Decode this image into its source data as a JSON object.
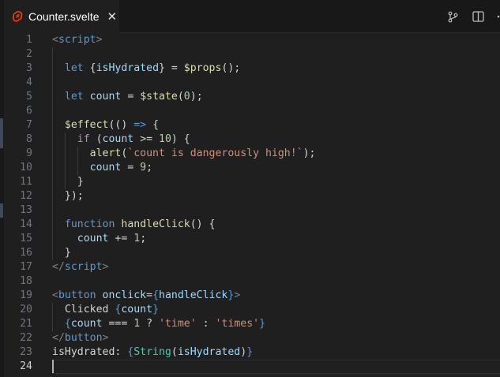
{
  "tab": {
    "title": "Counter.svelte",
    "close_glyph": "✕",
    "icon": "svelte-logo-icon"
  },
  "actions": [
    {
      "name": "source-control-icon"
    },
    {
      "name": "split-editor-icon"
    }
  ],
  "editor": {
    "active_line": 24,
    "lines": [
      {
        "n": 1,
        "tokens": [
          [
            "t-angle",
            "<"
          ],
          [
            "t-tag",
            "script"
          ],
          [
            "t-angle",
            ">"
          ]
        ]
      },
      {
        "n": 2,
        "tokens": []
      },
      {
        "n": 3,
        "tokens": [
          [
            "t-pun",
            "  "
          ],
          [
            "t-kw",
            "let"
          ],
          [
            "t-pun",
            " {"
          ],
          [
            "t-var",
            "isHydrated"
          ],
          [
            "t-pun",
            "} = "
          ],
          [
            "t-fn",
            "$props"
          ],
          [
            "t-pun",
            "();"
          ]
        ]
      },
      {
        "n": 4,
        "tokens": []
      },
      {
        "n": 5,
        "tokens": [
          [
            "t-pun",
            "  "
          ],
          [
            "t-kw",
            "let"
          ],
          [
            "t-pun",
            " "
          ],
          [
            "t-var",
            "count"
          ],
          [
            "t-pun",
            " = "
          ],
          [
            "t-fn",
            "$state"
          ],
          [
            "t-pun",
            "("
          ],
          [
            "t-num",
            "0"
          ],
          [
            "t-pun",
            ");"
          ]
        ]
      },
      {
        "n": 6,
        "tokens": []
      },
      {
        "n": 7,
        "tokens": [
          [
            "t-pun",
            "  "
          ],
          [
            "t-fn",
            "$effect"
          ],
          [
            "t-pun",
            "(() "
          ],
          [
            "t-kw",
            "=>"
          ],
          [
            "t-pun",
            " {"
          ]
        ]
      },
      {
        "n": 8,
        "tokens": [
          [
            "t-pun",
            "    "
          ],
          [
            "t-ctl",
            "if"
          ],
          [
            "t-pun",
            " ("
          ],
          [
            "t-var",
            "count"
          ],
          [
            "t-pun",
            " >= "
          ],
          [
            "t-num",
            "10"
          ],
          [
            "t-pun",
            ") {"
          ]
        ]
      },
      {
        "n": 9,
        "tokens": [
          [
            "t-pun",
            "      "
          ],
          [
            "t-fn",
            "alert"
          ],
          [
            "t-pun",
            "("
          ],
          [
            "t-str",
            "`count is dangerously high!`"
          ],
          [
            "t-pun",
            ");"
          ]
        ]
      },
      {
        "n": 10,
        "tokens": [
          [
            "t-pun",
            "      "
          ],
          [
            "t-var",
            "count"
          ],
          [
            "t-pun",
            " = "
          ],
          [
            "t-num",
            "9"
          ],
          [
            "t-pun",
            ";"
          ]
        ]
      },
      {
        "n": 11,
        "tokens": [
          [
            "t-pun",
            "    }"
          ]
        ]
      },
      {
        "n": 12,
        "tokens": [
          [
            "t-pun",
            "  });"
          ]
        ]
      },
      {
        "n": 13,
        "tokens": []
      },
      {
        "n": 14,
        "tokens": [
          [
            "t-pun",
            "  "
          ],
          [
            "t-kw",
            "function"
          ],
          [
            "t-pun",
            " "
          ],
          [
            "t-fn",
            "handleClick"
          ],
          [
            "t-pun",
            "() {"
          ]
        ]
      },
      {
        "n": 15,
        "tokens": [
          [
            "t-pun",
            "    "
          ],
          [
            "t-var",
            "count"
          ],
          [
            "t-pun",
            " += "
          ],
          [
            "t-num",
            "1"
          ],
          [
            "t-pun",
            ";"
          ]
        ]
      },
      {
        "n": 16,
        "tokens": [
          [
            "t-pun",
            "  }"
          ]
        ]
      },
      {
        "n": 17,
        "tokens": [
          [
            "t-angle",
            "</"
          ],
          [
            "t-tag",
            "script"
          ],
          [
            "t-angle",
            ">"
          ]
        ]
      },
      {
        "n": 18,
        "tokens": []
      },
      {
        "n": 19,
        "tokens": [
          [
            "t-angle",
            "<"
          ],
          [
            "t-tag",
            "button"
          ],
          [
            "t-pun",
            " "
          ],
          [
            "t-var",
            "onclick"
          ],
          [
            "t-pun",
            "="
          ],
          [
            "t-brace",
            "{"
          ],
          [
            "t-var",
            "handleClick"
          ],
          [
            "t-brace",
            "}"
          ],
          [
            "t-angle",
            ">"
          ]
        ]
      },
      {
        "n": 20,
        "tokens": [
          [
            "t-txt",
            "  Clicked "
          ],
          [
            "t-brace",
            "{"
          ],
          [
            "t-var",
            "count"
          ],
          [
            "t-brace",
            "}"
          ]
        ]
      },
      {
        "n": 21,
        "tokens": [
          [
            "t-pun",
            "  "
          ],
          [
            "t-brace",
            "{"
          ],
          [
            "t-var",
            "count"
          ],
          [
            "t-pun",
            " === "
          ],
          [
            "t-num",
            "1"
          ],
          [
            "t-pun",
            " ? "
          ],
          [
            "t-str",
            "'time'"
          ],
          [
            "t-pun",
            " : "
          ],
          [
            "t-str",
            "'times'"
          ],
          [
            "t-brace",
            "}"
          ]
        ]
      },
      {
        "n": 22,
        "tokens": [
          [
            "t-angle",
            "</"
          ],
          [
            "t-tag",
            "button"
          ],
          [
            "t-angle",
            ">"
          ]
        ]
      },
      {
        "n": 23,
        "tokens": [
          [
            "t-txt",
            "isHydrated: "
          ],
          [
            "t-brace",
            "{"
          ],
          [
            "t-type",
            "String"
          ],
          [
            "t-pun",
            "("
          ],
          [
            "t-var",
            "isHydrated"
          ],
          [
            "t-pun",
            ")"
          ],
          [
            "t-brace",
            "}"
          ]
        ]
      },
      {
        "n": 24,
        "tokens": []
      }
    ]
  }
}
